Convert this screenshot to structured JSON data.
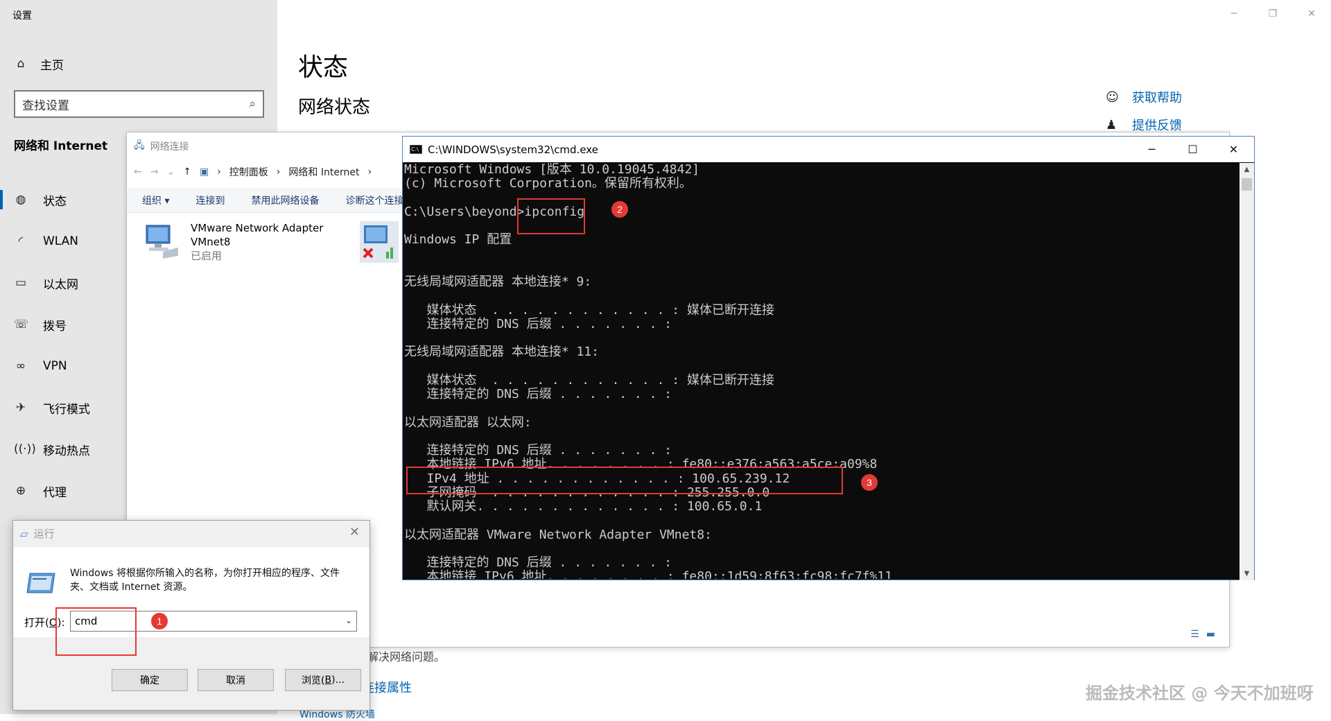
{
  "settings": {
    "app_title": "设置",
    "window_controls": [
      "─",
      "❐",
      "✕"
    ],
    "home_label": "主页",
    "search_placeholder": "查找设置",
    "group_title": "网络和 Internet",
    "nav_items": [
      {
        "label": "状态",
        "icon": "globe-status-icon"
      },
      {
        "label": "WLAN",
        "icon": "wifi-icon"
      },
      {
        "label": "以太网",
        "icon": "ethernet-icon"
      },
      {
        "label": "拨号",
        "icon": "dialup-icon"
      },
      {
        "label": "VPN",
        "icon": "vpn-icon"
      },
      {
        "label": "飞行模式",
        "icon": "airplane-icon"
      },
      {
        "label": "移动热点",
        "icon": "hotspot-icon"
      },
      {
        "label": "代理",
        "icon": "proxy-globe-icon"
      }
    ],
    "page_title": "状态",
    "page_subtitle": "网络状态",
    "help_links": [
      "获取帮助",
      "提供反馈"
    ],
    "partial_text": "解决网络问题。",
    "partial_link": "连接属性",
    "partial_link2": "Windows 防火墙"
  },
  "network_connections": {
    "title": "网络连接",
    "breadcrumb": [
      "控制面板",
      "网络和 Internet"
    ],
    "toolbar": [
      "组织 ▾",
      "连接到",
      "禁用此网络设备",
      "诊断这个连接"
    ],
    "adapter": {
      "name": "VMware Network Adapter",
      "name2": "VMnet8",
      "status": "已启用"
    }
  },
  "cmd": {
    "title": "C:\\WINDOWS\\system32\\cmd.exe",
    "lines": [
      "Microsoft Windows [版本 10.0.19045.4842]",
      "(c) Microsoft Corporation。保留所有权利。",
      "",
      "C:\\Users\\beyond>ipconfig",
      "",
      "Windows IP 配置",
      "",
      "",
      "无线局域网适配器 本地连接* 9:",
      "",
      "   媒体状态  . . . . . . . . . . . . : 媒体已断开连接",
      "   连接特定的 DNS 后缀 . . . . . . . :",
      "",
      "无线局域网适配器 本地连接* 11:",
      "",
      "   媒体状态  . . . . . . . . . . . . : 媒体已断开连接",
      "   连接特定的 DNS 后缀 . . . . . . . :",
      "",
      "以太网适配器 以太网:",
      "",
      "   连接特定的 DNS 后缀 . . . . . . . :",
      "   本地链接 IPv6 地址. . . . . . . . : fe80::e376:a563:a5ce:a09%8",
      "   IPv4 地址 . . . . . . . . . . . . : 100.65.239.12",
      "   子网掩码  . . . . . . . . . . . . : 255.255.0.0",
      "   默认网关. . . . . . . . . . . . . : 100.65.0.1",
      "",
      "以太网适配器 VMware Network Adapter VMnet8:",
      "",
      "   连接特定的 DNS 后缀 . . . . . . . :",
      "   本地链接 IPv6 地址. . . . . . . . : fe80::1d59:8f63:fc98:fc7f%11"
    ]
  },
  "run_dialog": {
    "title": "运行",
    "description": "Windows 将根据你所输入的名称，为你打开相应的程序、文件夹、文档或 Internet 资源。",
    "open_label": "打开(",
    "open_key": "O",
    "open_label_end": "):",
    "input_value": "cmd",
    "ok_label": "确定",
    "cancel_label": "取消",
    "browse_label": "浏览(",
    "browse_key": "B",
    "browse_end": ")..."
  },
  "annotations": {
    "badge1": "1",
    "badge2": "2",
    "badge3": "3",
    "accent_color": "#e53935"
  },
  "watermark": "掘金技术社区 @ 今天不加班呀"
}
